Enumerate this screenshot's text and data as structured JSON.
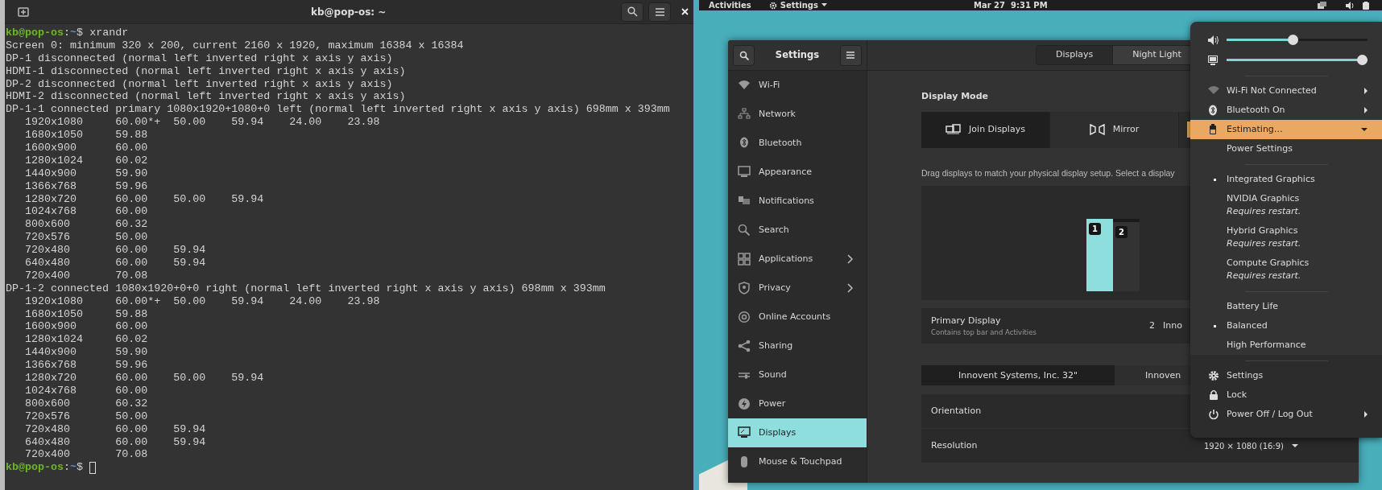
{
  "terminal": {
    "title": "kb@pop-os: ~",
    "lines": [
      {
        "kind": "prompt",
        "user": "kb@pop-os",
        "separator": ":",
        "path": "~",
        "symbol": "$",
        "command": "xrandr",
        "cursor": false
      },
      {
        "kind": "output",
        "text": "Screen 0: minimum 320 x 200, current 2160 x 1920, maximum 16384 x 16384"
      },
      {
        "kind": "output",
        "text": "DP-1 disconnected (normal left inverted right x axis y axis)"
      },
      {
        "kind": "output",
        "text": "HDMI-1 disconnected (normal left inverted right x axis y axis)"
      },
      {
        "kind": "output",
        "text": "DP-2 disconnected (normal left inverted right x axis y axis)"
      },
      {
        "kind": "output",
        "text": "HDMI-2 disconnected (normal left inverted right x axis y axis)"
      },
      {
        "kind": "output",
        "text": "DP-1-1 connected primary 1080x1920+1080+0 left (normal left inverted right x axis y axis) 698mm x 393mm"
      },
      {
        "kind": "output",
        "text": "   1920x1080     60.00*+  50.00    59.94    24.00    23.98"
      },
      {
        "kind": "output",
        "text": "   1680x1050     59.88"
      },
      {
        "kind": "output",
        "text": "   1600x900      60.00"
      },
      {
        "kind": "output",
        "text": "   1280x1024     60.02"
      },
      {
        "kind": "output",
        "text": "   1440x900      59.90"
      },
      {
        "kind": "output",
        "text": "   1366x768      59.96"
      },
      {
        "kind": "output",
        "text": "   1280x720      60.00    50.00    59.94"
      },
      {
        "kind": "output",
        "text": "   1024x768      60.00"
      },
      {
        "kind": "output",
        "text": "   800x600       60.32"
      },
      {
        "kind": "output",
        "text": "   720x576       50.00"
      },
      {
        "kind": "output",
        "text": "   720x480       60.00    59.94"
      },
      {
        "kind": "output",
        "text": "   640x480       60.00    59.94"
      },
      {
        "kind": "output",
        "text": "   720x400       70.08"
      },
      {
        "kind": "output",
        "text": "DP-1-2 connected 1080x1920+0+0 right (normal left inverted right x axis y axis) 698mm x 393mm"
      },
      {
        "kind": "output",
        "text": "   1920x1080     60.00*+  50.00    59.94    24.00    23.98"
      },
      {
        "kind": "output",
        "text": "   1680x1050     59.88"
      },
      {
        "kind": "output",
        "text": "   1600x900      60.00"
      },
      {
        "kind": "output",
        "text": "   1280x1024     60.02"
      },
      {
        "kind": "output",
        "text": "   1440x900      59.90"
      },
      {
        "kind": "output",
        "text": "   1366x768      59.96"
      },
      {
        "kind": "output",
        "text": "   1280x720      60.00    50.00    59.94"
      },
      {
        "kind": "output",
        "text": "   1024x768      60.00"
      },
      {
        "kind": "output",
        "text": "   800x600       60.32"
      },
      {
        "kind": "output",
        "text": "   720x576       50.00"
      },
      {
        "kind": "output",
        "text": "   720x480       60.00    59.94"
      },
      {
        "kind": "output",
        "text": "   640x480       60.00    59.94"
      },
      {
        "kind": "output",
        "text": "   720x400       70.08"
      },
      {
        "kind": "prompt",
        "user": "kb@pop-os",
        "separator": ":",
        "path": "~",
        "symbol": "$",
        "cursor": true
      }
    ]
  },
  "top_bar": {
    "activities": "Activities",
    "app_menu": "Settings",
    "clock": "Mar 27  9:31 PM"
  },
  "settings": {
    "title": "Settings",
    "tabs": [
      {
        "label": "Displays",
        "selected": true
      },
      {
        "label": "Night Light",
        "selected": false
      }
    ],
    "sidebar": [
      {
        "label": "Wi-Fi",
        "arrow": false,
        "selected": false
      },
      {
        "label": "Network",
        "arrow": false,
        "selected": false
      },
      {
        "label": "Bluetooth",
        "arrow": false,
        "selected": false
      },
      {
        "label": "Appearance",
        "arrow": false,
        "selected": false
      },
      {
        "label": "Notifications",
        "arrow": false,
        "selected": false
      },
      {
        "label": "Search",
        "arrow": false,
        "selected": false
      },
      {
        "label": "Applications",
        "arrow": true,
        "selected": false
      },
      {
        "label": "Privacy",
        "arrow": true,
        "selected": false
      },
      {
        "label": "Online Accounts",
        "arrow": false,
        "selected": false
      },
      {
        "label": "Sharing",
        "arrow": false,
        "selected": false
      },
      {
        "label": "Sound",
        "arrow": false,
        "selected": false
      },
      {
        "label": "Power",
        "arrow": false,
        "selected": false
      },
      {
        "label": "Displays",
        "arrow": false,
        "selected": true
      },
      {
        "label": "Mouse & Touchpad",
        "arrow": false,
        "selected": false
      }
    ],
    "display_mode": {
      "heading": "Display Mode",
      "options": [
        {
          "label": "Join Displays",
          "selected": true
        },
        {
          "label": "Mirror",
          "selected": false
        }
      ]
    },
    "arrangement_hint": "Drag displays to match your physical display setup. Select a display",
    "displays": [
      {
        "number": "1",
        "selected": true
      },
      {
        "number": "2",
        "selected": false
      }
    ],
    "primary_display": {
      "label": "Primary Display",
      "description": "Contains top bar and Activities",
      "number": "2",
      "name": "Inno"
    },
    "monitor_tabs": [
      {
        "label": "Innovent Systems, Inc. 32\"",
        "selected": true
      },
      {
        "label": "Innoven",
        "selected": false
      }
    ],
    "rows": [
      {
        "label": "Orientation"
      },
      {
        "label": "Resolution",
        "value": "1920 × 1080 (16:9)"
      }
    ]
  },
  "system_menu": {
    "sliders": [
      {
        "level": 0.47
      },
      {
        "level": 1.0
      }
    ],
    "sections": [
      {
        "items": [
          {
            "kind": "submenu",
            "label": "Wi-Fi Not Connected",
            "arrow": true,
            "highlighted": false
          },
          {
            "kind": "submenu",
            "label": "Bluetooth On",
            "arrow": true,
            "highlighted": false
          },
          {
            "kind": "submenu",
            "label": "Estimating…",
            "expanded": true,
            "highlighted": true
          },
          {
            "kind": "plain",
            "label": "Power Settings"
          }
        ]
      },
      {
        "items": [
          {
            "kind": "radio",
            "label": "Integrated Graphics",
            "selected": true
          },
          {
            "kind": "radio",
            "label": "NVIDIA Graphics",
            "note": "Requires restart.",
            "selected": false
          },
          {
            "kind": "radio",
            "label": "Hybrid Graphics",
            "note": "Requires restart.",
            "selected": false
          },
          {
            "kind": "radio",
            "label": "Compute Graphics",
            "note": "Requires restart.",
            "selected": false
          }
        ]
      },
      {
        "items": [
          {
            "kind": "radio",
            "label": "Battery Life",
            "selected": false
          },
          {
            "kind": "radio",
            "label": "Balanced",
            "selected": true
          },
          {
            "kind": "radio",
            "label": "High Performance",
            "selected": false
          }
        ]
      },
      {
        "items": [
          {
            "kind": "submenu",
            "label": "Settings",
            "arrow": false,
            "highlighted": false
          },
          {
            "kind": "submenu",
            "label": "Lock",
            "arrow": false,
            "highlighted": false
          },
          {
            "kind": "submenu",
            "label": "Power Off / Log Out",
            "arrow": true,
            "highlighted": false
          }
        ]
      }
    ]
  }
}
